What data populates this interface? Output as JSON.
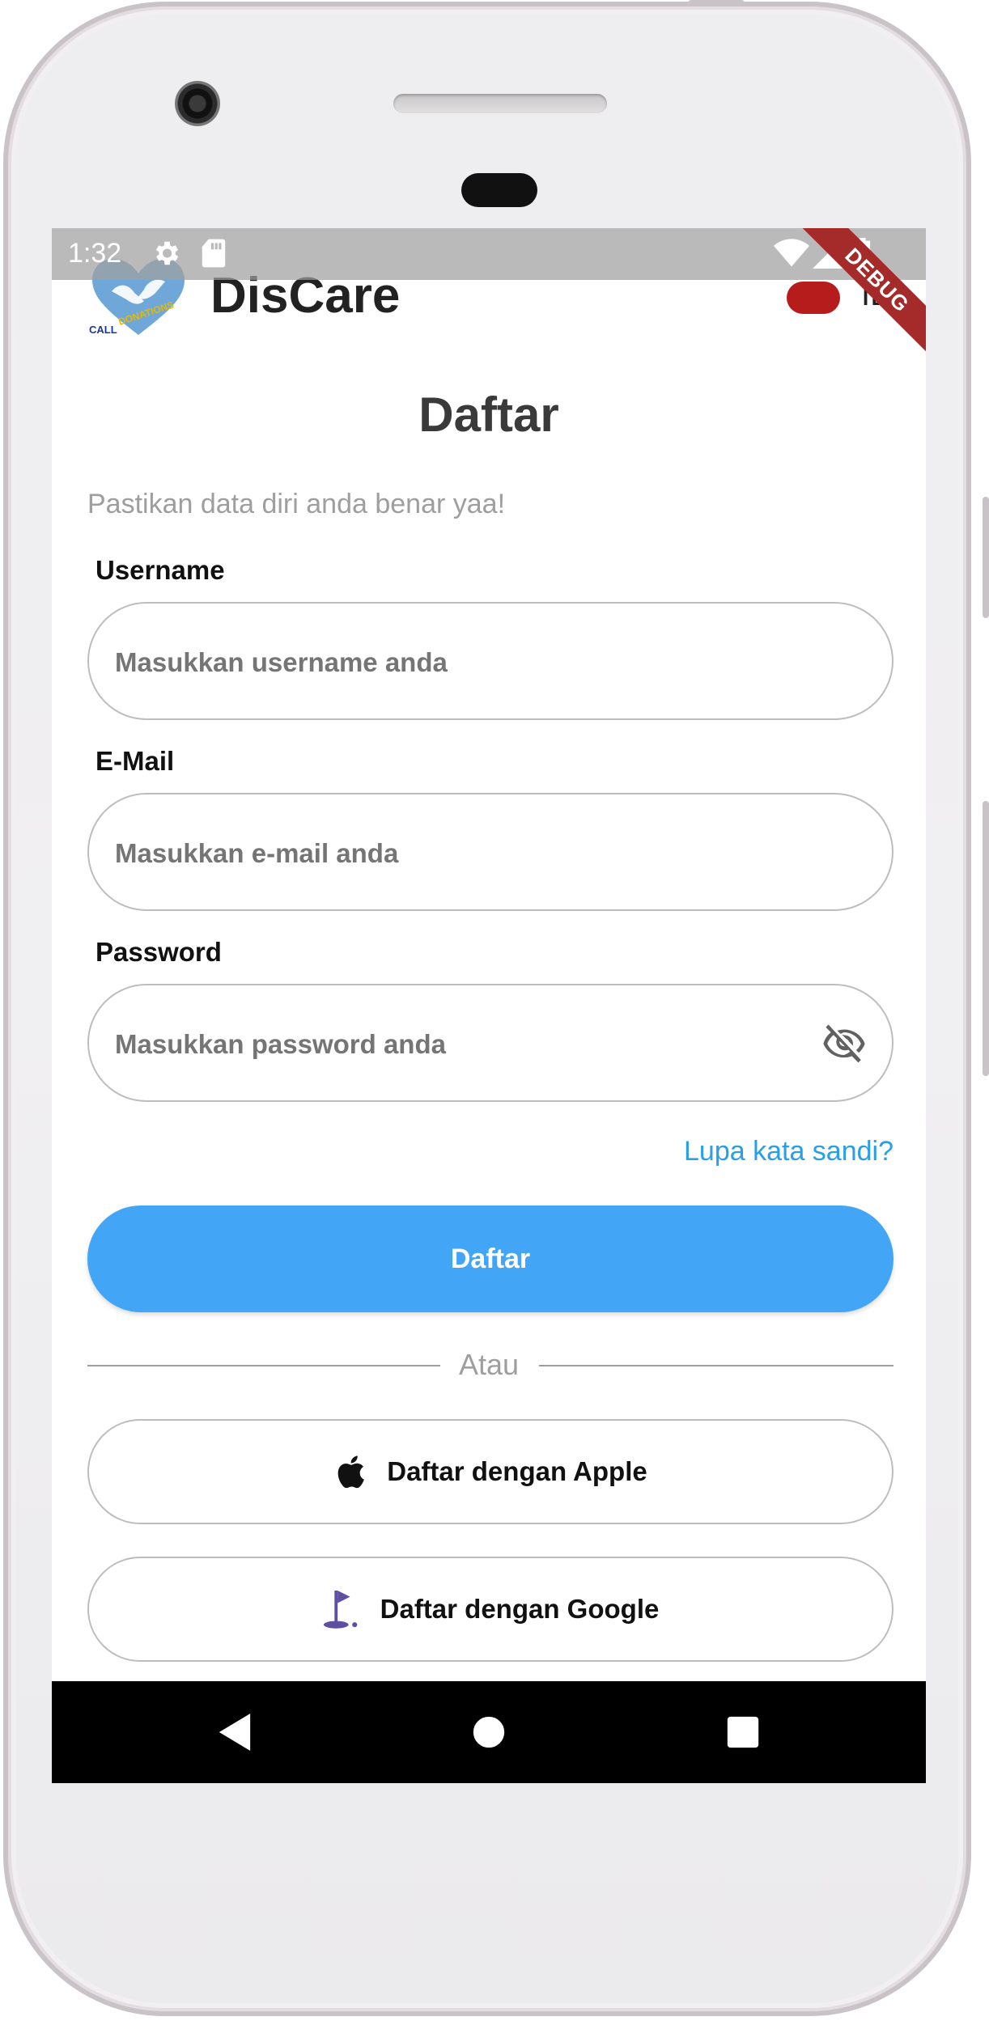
{
  "status_bar": {
    "time": "1:32"
  },
  "debug_banner": "DEBUG",
  "app": {
    "title": "DisCare",
    "language": "ID",
    "logo_text": "CALL for DONATIONS"
  },
  "page": {
    "heading": "Daftar",
    "subtitle": "Pastikan data diri anda benar yaa!"
  },
  "form": {
    "username": {
      "label": "Username",
      "placeholder": "Masukkan username anda"
    },
    "email": {
      "label": "E-Mail",
      "placeholder": "Masukkan e-mail anda"
    },
    "password": {
      "label": "Password",
      "placeholder": "Masukkan password anda"
    },
    "forgot_password": "Lupa kata sandi?",
    "submit_label": "Daftar"
  },
  "divider": "Atau",
  "social": {
    "apple_label": "Daftar dengan Apple",
    "google_label": "Daftar dengan Google"
  },
  "colors": {
    "primary": "#42a5f5",
    "link": "#2a9ee6",
    "toggle": "#b71c1c",
    "google_icon": "#5e4fa2"
  }
}
